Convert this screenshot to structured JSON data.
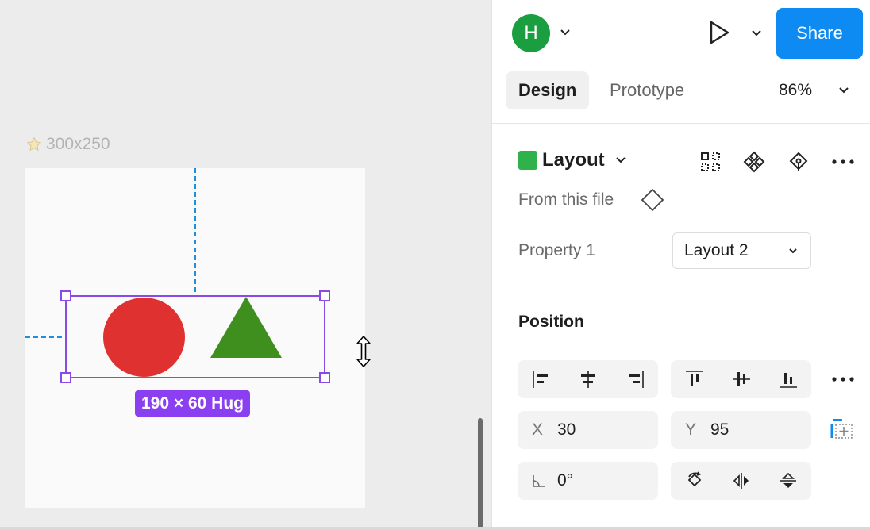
{
  "canvas": {
    "frame_label": "300x250",
    "size_badge": "190 × 60 Hug",
    "shape_colors": {
      "circle": "#e03131",
      "triangle": "#3f8f1f"
    },
    "selection_color": "#8a4ae8"
  },
  "toolbar": {
    "avatar_initial": "H",
    "share_label": "Share"
  },
  "tabs": {
    "design": "Design",
    "prototype": "Prototype"
  },
  "zoom": "86%",
  "component": {
    "name": "Layout",
    "source": "From this file",
    "property_label": "Property 1",
    "property_value": "Layout 2",
    "swatch_color": "#2fb24c"
  },
  "position": {
    "title": "Position",
    "x_label": "X",
    "x_value": "30",
    "y_label": "Y",
    "y_value": "95",
    "rotation_value": "0°"
  },
  "colors": {
    "accent": "#0d8bf2",
    "avatar": "#1a9e3f",
    "badge": "#8a3ff0"
  }
}
